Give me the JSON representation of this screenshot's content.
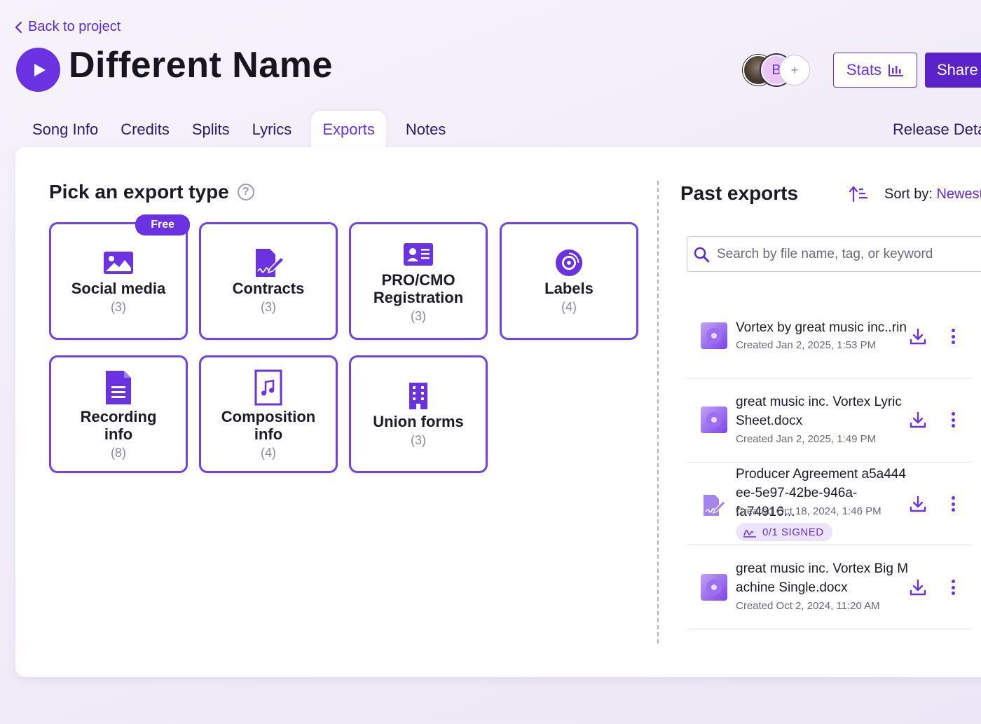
{
  "nav": {
    "back_label": "Back to project"
  },
  "project": {
    "title": "Different Name"
  },
  "collaborators": {
    "initial": "B",
    "add_symbol": "+"
  },
  "header_actions": {
    "stats_label": "Stats",
    "share_label": "Share"
  },
  "tabs": [
    {
      "label": "Song Info",
      "active": false
    },
    {
      "label": "Credits",
      "active": false
    },
    {
      "label": "Splits",
      "active": false
    },
    {
      "label": "Lyrics",
      "active": false
    },
    {
      "label": "Exports",
      "active": true
    },
    {
      "label": "Notes",
      "active": false
    }
  ],
  "release_tab": {
    "label": "Release Deta"
  },
  "export_types": {
    "title": "Pick an export type",
    "help_symbol": "?",
    "free_badge": "Free",
    "cards": [
      {
        "label": "Social media",
        "count": "(3)",
        "icon": "image-icon"
      },
      {
        "label": "Contracts",
        "count": "(3)",
        "icon": "contract-icon"
      },
      {
        "label": "PRO/CMO Registration",
        "count": "(3)",
        "icon": "id-card-icon"
      },
      {
        "label": "Labels",
        "count": "(4)",
        "icon": "vinyl-record-icon"
      },
      {
        "label": "Recording info",
        "count": "(8)",
        "icon": "document-icon"
      },
      {
        "label": "Composition info",
        "count": "(4)",
        "icon": "music-file-icon"
      },
      {
        "label": "Union forms",
        "count": "(3)",
        "icon": "building-icon"
      }
    ]
  },
  "past_exports": {
    "title": "Past exports",
    "sort_label": "Sort by:",
    "sort_value": "Newest",
    "search_placeholder": "Search by file name, tag, or keyword",
    "items": [
      {
        "name": "Vortex by great music inc..rin",
        "date": "Created Jan 2, 2025, 1:53 PM",
        "icon": "audio-file-icon"
      },
      {
        "name": "great music inc. Vortex Lyric Sheet.docx",
        "date": "Created Jan 2, 2025, 1:49 PM",
        "icon": "audio-file-icon"
      },
      {
        "name": "Producer Agreement a5a444 ee-5e97-42be-946a-fa74916...",
        "date": "Created Oct 18, 2024, 1:46 PM",
        "icon": "contract-icon",
        "badge": "0/1 SIGNED"
      },
      {
        "name": "great music inc. Vortex Big M achine Single.docx",
        "date": "Created Oct 2, 2024, 11:20 AM",
        "icon": "audio-file-icon"
      }
    ]
  },
  "colors": {
    "accent": "#6a32e0",
    "accent_dark": "#5a22c9",
    "text": "#1d1b26",
    "muted": "#8e8a9a"
  }
}
